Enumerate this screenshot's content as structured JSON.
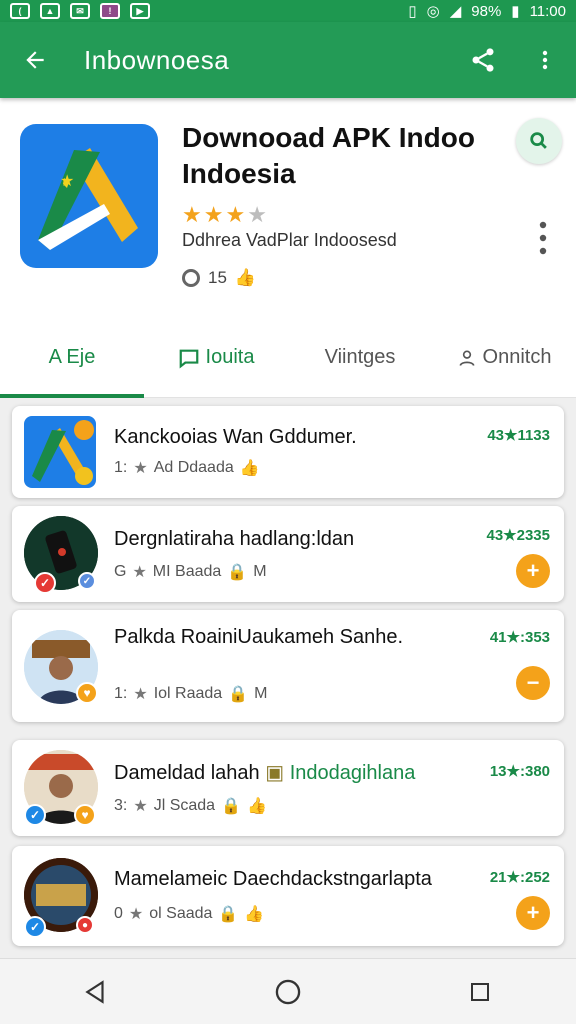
{
  "status_bar": {
    "battery": "98%",
    "time": "11:00"
  },
  "app_bar": {
    "title": "Inbownoesa"
  },
  "app": {
    "title": "Downooad APK Indoo Indoesia",
    "rating_stars": 3,
    "developer": "Ddhrea VadPlar Indoosesd",
    "meta_count": "15"
  },
  "tabs": [
    {
      "label": "A Eje"
    },
    {
      "label": "Iouita"
    },
    {
      "label": "Viintges"
    },
    {
      "label": "Onnitch"
    }
  ],
  "list": [
    {
      "title": "Kanckooias Wan Gddumer.",
      "sub_prefix": "1:",
      "sub_text": "Ad Ddaada",
      "rating": "43★1133"
    },
    {
      "title": "Dergnlatiraha hadlang:ldan",
      "sub_prefix": "G",
      "sub_text": "MI Baada",
      "sub_suffix": "M",
      "rating": "43★2335"
    },
    {
      "title": "Palkda RoainiUaukameh Sanhe.",
      "sub_prefix": "1:",
      "sub_text": "Iol Raada",
      "sub_suffix": "M",
      "rating": "41★:353"
    },
    {
      "title": "Dameldad lahah",
      "title_extra": "Indodagihlana",
      "sub_prefix": "3:",
      "sub_text": "Jl Scada",
      "rating": "13★:380"
    },
    {
      "title": "Mamelameic Daechdackstngarlapta",
      "sub_prefix": "0",
      "sub_text": "ol Saada",
      "rating": "21★:252"
    }
  ],
  "colors": {
    "primary": "#239b56",
    "accent": "#f4a21a",
    "rating_text": "#1a8a48"
  }
}
